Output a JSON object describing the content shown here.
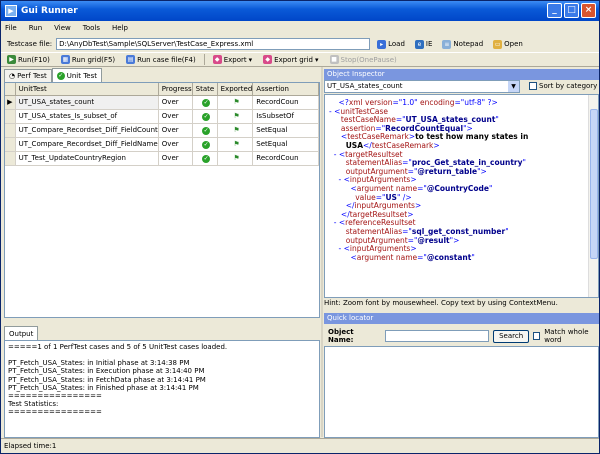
{
  "window": {
    "title": "Gui Runner"
  },
  "menu": [
    "File",
    "Run",
    "View",
    "Tools",
    "Help"
  ],
  "testcase_bar": {
    "label": "Testcase file:",
    "path": "D:\\AnyDbTest\\Sample\\SQLServer\\TestCase_Express.xml",
    "load": "Load",
    "ie": "IE",
    "notepad": "Notepad",
    "open": "Open"
  },
  "toolbar": {
    "run": "Run(F10)",
    "run_grid": "Run grid(F5)",
    "run_case": "Run case file(F4)",
    "export": "Export",
    "export_grid": "Export grid",
    "stop": "Stop(OnePause)"
  },
  "tabs": {
    "perf": "Perf Test",
    "unit": "Unit Test"
  },
  "grid": {
    "headers": [
      "UnitTest",
      "Progress",
      "State",
      "Exported",
      "Assertion"
    ],
    "rows": [
      {
        "name": "UT_USA_states_count",
        "progress": "Over",
        "assertion": "RecordCoun"
      },
      {
        "name": "UT_USA_states_Is_subset_of",
        "progress": "Over",
        "assertion": "IsSubsetOf"
      },
      {
        "name": "UT_Compare_Recordset_Diff_FieldCount",
        "progress": "Over",
        "assertion": "SetEqual"
      },
      {
        "name": "UT_Compare_Recordset_Diff_FieldName",
        "progress": "Over",
        "assertion": "SetEqual"
      },
      {
        "name": "UT_Test_UpdateCountryRegion",
        "progress": "Over",
        "assertion": "RecordCoun"
      }
    ]
  },
  "output": {
    "tab": "Output",
    "lines": [
      "=====1 of 1 PerfTest cases and 5 of 5 UnitTest cases loaded.",
      "",
      "PT_Fetch_USA_States: in Initial phase at 3:14:38 PM",
      "PT_Fetch_USA_States: in Execution phase at 3:14:40 PM",
      "PT_Fetch_USA_States: in FetchData phase at 3:14:41 PM",
      "PT_Fetch_USA_States: in Finished phase at 3:14:41 PM",
      "================",
      "Test Statistics:",
      "================"
    ]
  },
  "inspector": {
    "title": "Object Inspector",
    "selected": "UT_USA_states_count",
    "sort_label": "Sort by category",
    "hint": "Hint: Zoom font by mousewheel. Copy text by using ContextMenu."
  },
  "quick": {
    "title": "Quick locator",
    "label": "Object Name:",
    "search": "Search",
    "match": "Match whole word"
  },
  "status": {
    "text": "Elapsed time:1"
  },
  "colors": {
    "title_bar": "#0a5ad8",
    "tag": "#a31515",
    "value": "#00008b",
    "check": "#2aa22a"
  }
}
